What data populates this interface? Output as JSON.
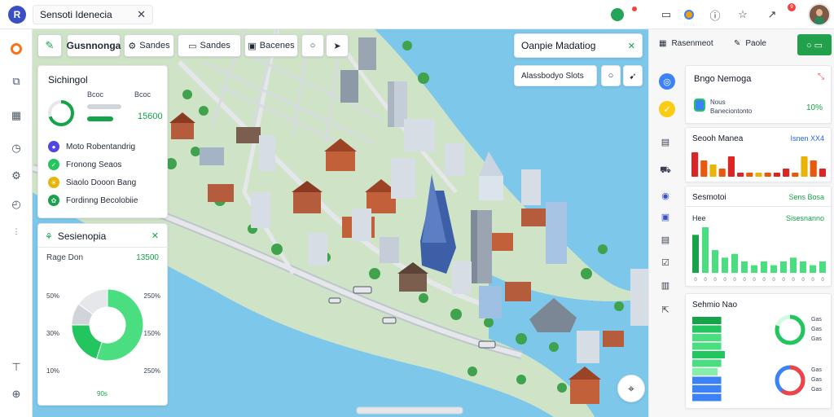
{
  "topbar": {
    "search_value": "Sensoti Idenecia",
    "clear_label": "✕",
    "notification_count": "9"
  },
  "map_toolbar": {
    "layer_label": "Gusnnonga",
    "btn2_label": "Sandes",
    "btn3_label": "Sandes",
    "btn4_label": "Bacenes"
  },
  "search_card": {
    "title": "Oanpie Madatiog",
    "close": "✕",
    "input_value": "Alassbodyo Slots"
  },
  "stats_card": {
    "title": "Sichingol",
    "label_a": "Bcoc",
    "label_b": "Bcoc",
    "value": "15600",
    "gauge_percent": 0.7,
    "legend": [
      {
        "label": "Moto Robentandrig",
        "color": "#4f46e5",
        "icon": "map-pin-icon"
      },
      {
        "label": "Fronong Seaos",
        "color": "#22c55e",
        "icon": "leaf-icon"
      },
      {
        "label": "Siaolo Dooon Bang",
        "color": "#eab308",
        "icon": "sun-icon"
      },
      {
        "label": "Fordinng Becolobiie",
        "color": "#16a34a",
        "icon": "tree-icon"
      }
    ]
  },
  "pie_card": {
    "title": "Sesienopia",
    "close": "✕",
    "subtitle": "Rage Don",
    "value": "13500",
    "left_ticks": [
      "50%",
      "30%",
      "10%"
    ],
    "right_ticks": [
      "250%",
      "150%",
      "250%"
    ],
    "footer": "90s",
    "slices": [
      {
        "value": 55,
        "color": "#4ade80"
      },
      {
        "value": 20,
        "color": "#22c55e"
      },
      {
        "value": 10,
        "color": "#d1d5db"
      },
      {
        "value": 15,
        "color": "#e5e7eb"
      }
    ]
  },
  "right_header": {
    "tab1": "Rasenmeot",
    "tab2": "Paole",
    "action_icon": "search-icon"
  },
  "right_cards": {
    "info": {
      "title": "Bngo Nemoga",
      "line1": "Nous",
      "line2": "Baneciontonto",
      "value": "10%"
    },
    "bars1": {
      "title": "Seooh Manea",
      "value": "Isnen XX4",
      "values": [
        6,
        4,
        3,
        2,
        5,
        1,
        1,
        1,
        1,
        1,
        2,
        1,
        5,
        4,
        2
      ]
    },
    "bars2": {
      "title": "Sesmotoi",
      "value": "Sens Bosa",
      "sub": "Hee",
      "sub_value": "Sisesnanno",
      "values": [
        10,
        12,
        6,
        4,
        5,
        3,
        2,
        3,
        2,
        3,
        4,
        3,
        2,
        3
      ]
    },
    "bars3": {
      "title": "Sehmio Nao",
      "hvalues": [
        8,
        8,
        8,
        8,
        9,
        8,
        7,
        8,
        8,
        8
      ],
      "ring1": {
        "label_a": "Gas",
        "label_b": "Gas",
        "label_c": "Gas",
        "percent": 0.8
      },
      "ring2": {
        "label_a": "Gas",
        "label_b": "Gas",
        "label_c": "Gas",
        "percent": 0.6
      }
    }
  }
}
